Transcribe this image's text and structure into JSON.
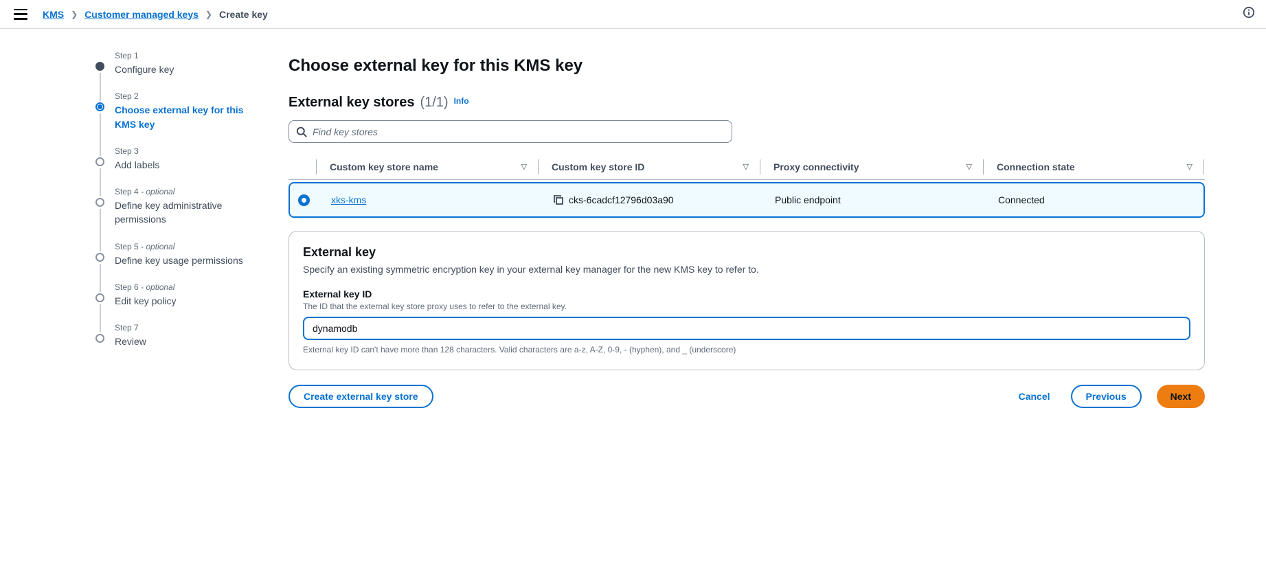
{
  "topbar": {
    "breadcrumb": {
      "kms": "KMS",
      "customer_managed_keys": "Customer managed keys",
      "create_key": "Create key"
    }
  },
  "steps": {
    "items": [
      {
        "step": "Step 1",
        "suffix": "",
        "title": "Configure key",
        "state": "complete"
      },
      {
        "step": "Step 2",
        "suffix": "",
        "title": "Choose external key for this KMS key",
        "state": "current"
      },
      {
        "step": "Step 3",
        "suffix": "",
        "title": "Add labels",
        "state": "upcoming"
      },
      {
        "step": "Step 4",
        "suffix": "- optional",
        "title": "Define key administrative permissions",
        "state": "upcoming"
      },
      {
        "step": "Step 5",
        "suffix": "- optional",
        "title": "Define key usage permissions",
        "state": "upcoming"
      },
      {
        "step": "Step 6",
        "suffix": "- optional",
        "title": "Edit key policy",
        "state": "upcoming"
      },
      {
        "step": "Step 7",
        "suffix": "",
        "title": "Review",
        "state": "upcoming"
      }
    ]
  },
  "main": {
    "title": "Choose external key for this KMS key",
    "key_stores": {
      "heading": "External key stores",
      "counter": "(1/1)",
      "info_label": "Info",
      "search_placeholder": "Find key stores",
      "table": {
        "columns": [
          "Custom key store name",
          "Custom key store ID",
          "Proxy connectivity",
          "Connection state"
        ],
        "rows": [
          {
            "name": "xks-kms",
            "id": "cks-6cadcf12796d03a90",
            "proxy": "Public endpoint",
            "state": "Connected",
            "selected": true
          }
        ]
      }
    },
    "external_key": {
      "heading": "External key",
      "description": "Specify an existing symmetric encryption key in your external key manager for the new KMS key to refer to.",
      "field_label": "External key ID",
      "field_description": "The ID that the external key store proxy uses to refer to the external key.",
      "field_value": "dynamodb",
      "field_hint": "External key ID can't have more than 128 characters. Valid characters are a-z, A-Z, 0-9, - (hyphen), and _ (underscore)"
    },
    "footer": {
      "create_store_label": "Create external key store",
      "cancel_label": "Cancel",
      "previous_label": "Previous",
      "next_label": "Next"
    }
  },
  "colors": {
    "link_blue": "#0972d3",
    "accent_orange": "#ee7d11",
    "selected_row_bg": "#f0fbff",
    "selected_row_border": "#0972d3",
    "secondary_text": "#5f6b7a"
  }
}
